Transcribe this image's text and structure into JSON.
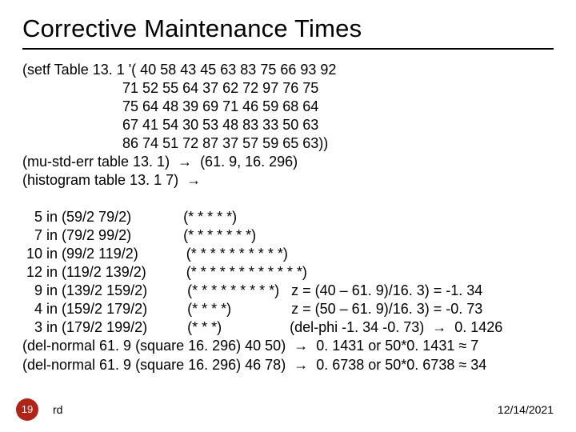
{
  "title": "Corrective Maintenance Times",
  "code_line1": "(setf Table 13. 1 '( 40 58 43 45 63 83 75 66 93 92",
  "code_line2": "                         71 52 55 64 37 62 72 97 76 75",
  "code_line3": "                         75 64 48 39 69 71 46 59 68 64",
  "code_line4": "                         67 41 54 30 53 48 83 33 50 63",
  "code_line5": "                         86 74 51 72 87 37 57 59 65 63))",
  "code_line6": "(mu-std-err table 13. 1)  →  (61. 9, 16. 296)",
  "code_line7": "(histogram table 13. 1 7)  →",
  "code_line8": "",
  "code_line9": "   5 in (59/2 79/2)             (* * * * *)",
  "code_line10": "   7 in (79/2 99/2)             (* * * * * * *)",
  "code_line11": " 10 in (99/2 119/2)            (* * * * * * * * * *)",
  "code_line12": " 12 in (119/2 139/2)          (* * * * * * * * * * * *)",
  "code_line13": "   9 in (139/2 159/2)          (* * * * * * * * *)   z = (40 – 61. 9)/16. 3) = -1. 34",
  "code_line14": "   4 in (159/2 179/2)          (* * * *)               z = (50 – 61. 9)/16. 3) = -0. 73",
  "code_line15": "   3 in (179/2 199/2)          (* * *)                 (del-phi -1. 34 -0. 73)  →  0. 1426",
  "code_line16": "(del-normal 61. 9 (square 16. 296) 40 50)  →  0. 1431 or 50*0. 1431 ≈ 7",
  "code_line17": "(del-normal 61. 9 (square 16. 296) 46 78)  →  0. 6738 or 50*0. 6738 ≈ 34",
  "footer": {
    "page": "19",
    "author": "rd",
    "date": "12/14/2021"
  }
}
